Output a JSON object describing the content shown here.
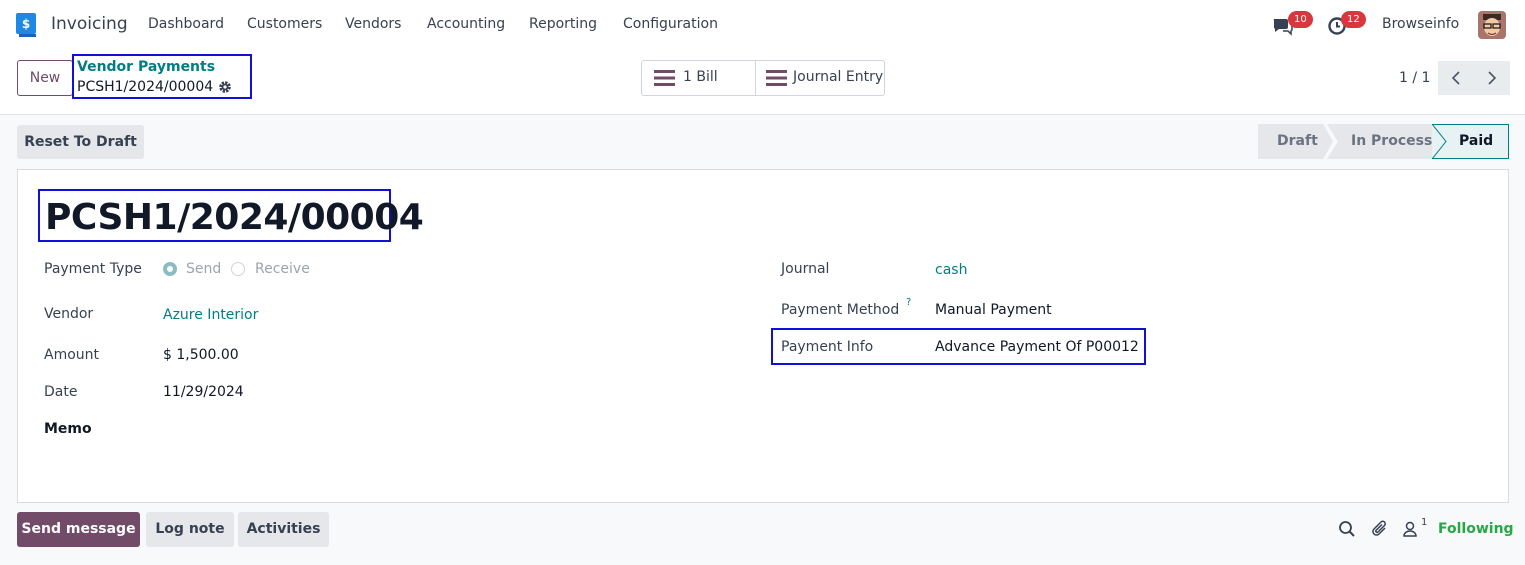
{
  "app": {
    "name": "Invoicing",
    "logo_icon": "invoicing-app-icon"
  },
  "menu": [
    "Dashboard",
    "Customers",
    "Vendors",
    "Accounting",
    "Reporting",
    "Configuration"
  ],
  "systray": {
    "messages_count": "10",
    "activities_count": "12",
    "company": "Browseinfo",
    "badge_color": "#d9363e"
  },
  "control_panel": {
    "new_label": "New",
    "breadcrumb_parent": "Vendor Payments",
    "breadcrumb_current": "PCSH1/2024/00004",
    "smart_buttons": {
      "bill": "1 Bill",
      "journal_entry": "Journal Entry"
    },
    "pager": "1 / 1"
  },
  "statusbar": {
    "reset_label": "Reset To Draft",
    "stages": [
      "Draft",
      "In Process",
      "Paid"
    ],
    "active_stage": "Paid"
  },
  "form": {
    "title": "PCSH1/2024/00004",
    "payment_type": {
      "label": "Payment Type",
      "options": [
        "Send",
        "Receive"
      ],
      "selected": "Send"
    },
    "vendor": {
      "label": "Vendor",
      "value": "Azure Interior"
    },
    "amount": {
      "label": "Amount",
      "value": "$ 1,500.00"
    },
    "date": {
      "label": "Date",
      "value": "11/29/2024"
    },
    "memo": {
      "label": "Memo",
      "value": ""
    },
    "journal": {
      "label": "Journal",
      "value": "cash"
    },
    "payment_method": {
      "label": "Payment Method",
      "help": "?",
      "value": "Manual Payment"
    },
    "payment_info": {
      "label": "Payment Info",
      "value": "Advance Payment Of P00012"
    }
  },
  "chatter": {
    "send_message": "Send message",
    "log_note": "Log note",
    "activities": "Activities",
    "followers_count": "1",
    "following": "Following"
  },
  "colors": {
    "primary": "#714b67",
    "link": "#017e84",
    "highlight_box": "#1010d8",
    "following": "#28a745"
  }
}
